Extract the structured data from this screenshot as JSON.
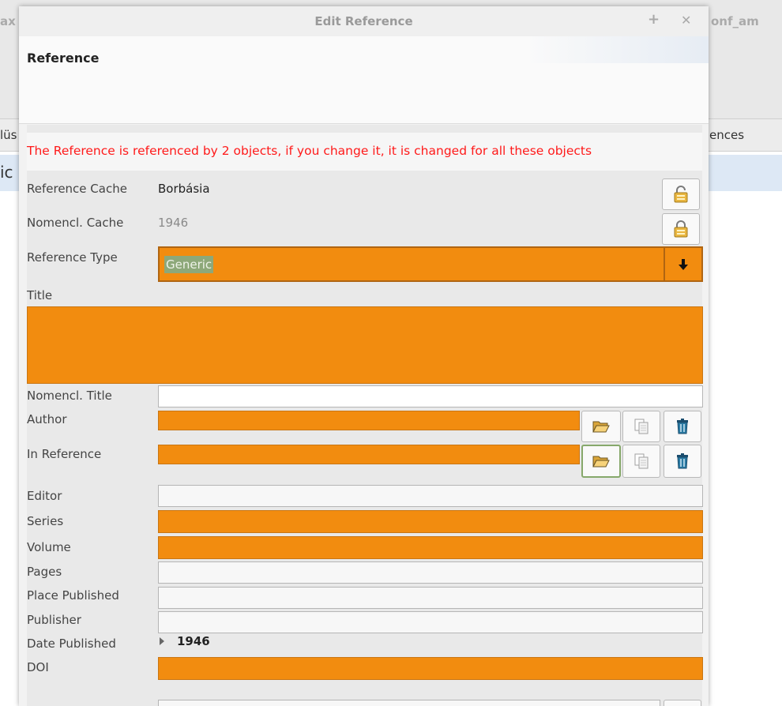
{
  "background": {
    "left_top_text": "ax",
    "right_top_text": "onf_am",
    "left_header_text": "lüs",
    "right_header_text": "ences",
    "left_row_text": "ic"
  },
  "dialog": {
    "title": "Edit Reference",
    "maximize_glyph": "+",
    "close_glyph": "✕",
    "section_title": "Reference",
    "warning": "The Reference is referenced by 2 objects, if you change it, it is changed for all these objects"
  },
  "form": {
    "reference_cache": {
      "label": "Reference Cache",
      "value": "Borbásia"
    },
    "nomencl_cache": {
      "label": "Nomencl. Cache",
      "value": "1946"
    },
    "reference_type": {
      "label": "Reference Type",
      "value": "Generic"
    },
    "title": {
      "label": "Title",
      "value": ""
    },
    "nomencl_title": {
      "label": "Nomencl. Title",
      "value": ""
    },
    "author": {
      "label": "Author",
      "value": ""
    },
    "in_reference": {
      "label": "In Reference",
      "value": ""
    },
    "editor": {
      "label": "Editor",
      "value": ""
    },
    "series": {
      "label": "Series",
      "value": ""
    },
    "volume": {
      "label": "Volume",
      "value": ""
    },
    "pages": {
      "label": "Pages",
      "value": ""
    },
    "place_published": {
      "label": "Place Published",
      "value": ""
    },
    "publisher": {
      "label": "Publisher",
      "value": ""
    },
    "date_published": {
      "label": "Date Published",
      "value": "1946"
    },
    "doi": {
      "label": "DOI",
      "value": ""
    }
  },
  "icons": {
    "lock": "lock-icon",
    "open": "folder-open-icon",
    "copy": "copy-icon",
    "delete": "trash-icon",
    "dropdown": "arrow-down-icon"
  },
  "colors": {
    "required_field": "#f28c0f",
    "warning_text": "#ff1a1a",
    "selection": "#8da879"
  }
}
